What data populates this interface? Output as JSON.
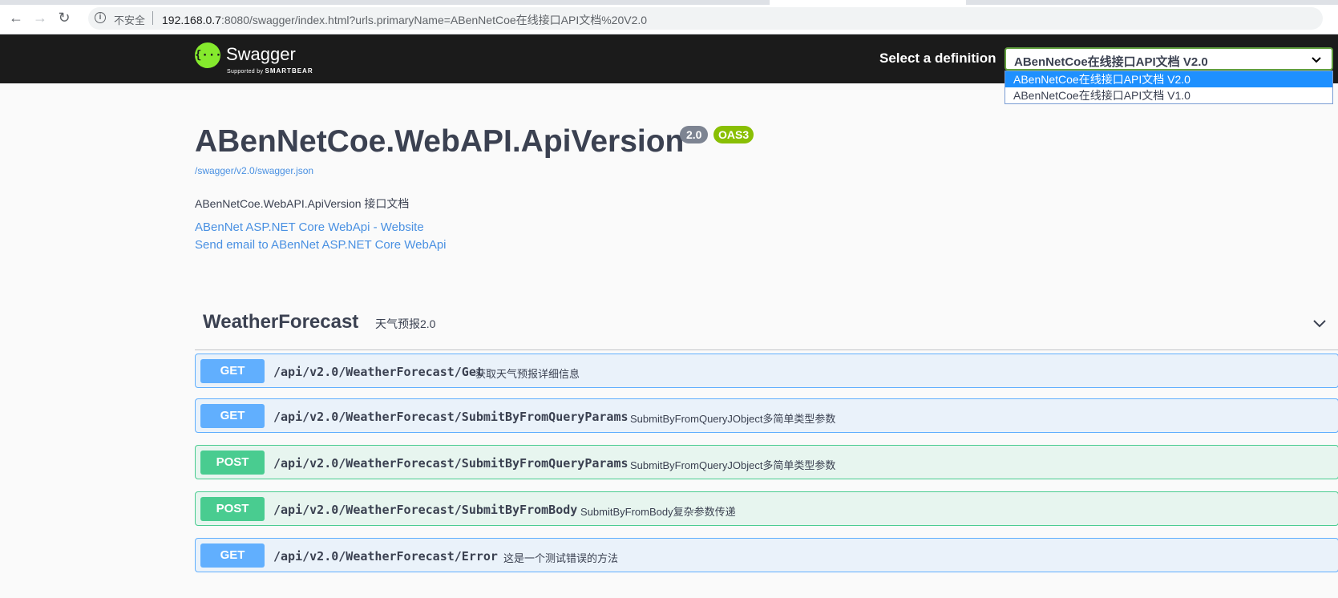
{
  "browser": {
    "insecure_label": "不安全",
    "url_host": "192.168.0.7",
    "url_rest": ":8080/swagger/index.html?urls.primaryName=ABenNetCoe在线接口API文档%20V2.0"
  },
  "topbar": {
    "logo_text": "Swagger",
    "logo_sub_prefix": "Supported by",
    "logo_sub_brand": "SMARTBEAR",
    "definition_label": "Select a definition",
    "definition_selected": "ABenNetCoe在线接口API文档 V2.0",
    "definition_options": [
      "ABenNetCoe在线接口API文档 V2.0",
      "ABenNetCoe在线接口API文档 V1.0"
    ]
  },
  "info": {
    "title": "ABenNetCoe.WebAPI.ApiVersion",
    "version": "2.0",
    "oas": "OAS3",
    "spec_url": "/swagger/v2.0/swagger.json",
    "description": "ABenNetCoe.WebAPI.ApiVersion 接口文档",
    "website_link": "ABenNet ASP.NET Core WebApi - Website",
    "email_link": "Send email to ABenNet ASP.NET Core WebApi"
  },
  "tag": {
    "name": "WeatherForecast",
    "description": "天气预报2.0"
  },
  "operations": [
    {
      "method": "GET",
      "path": "/api/v2.0/WeatherForecast/Get",
      "summary": "获取天气预报详细信息"
    },
    {
      "method": "GET",
      "path": "/api/v2.0/WeatherForecast/SubmitByFromQueryParams",
      "summary": "SubmitByFromQueryJObject多简单类型参数"
    },
    {
      "method": "POST",
      "path": "/api/v2.0/WeatherForecast/SubmitByFromQueryParams",
      "summary": "SubmitByFromQueryJObject多简单类型参数"
    },
    {
      "method": "POST",
      "path": "/api/v2.0/WeatherForecast/SubmitByFromBody",
      "summary": "SubmitByFromBody复杂参数传递"
    },
    {
      "method": "GET",
      "path": "/api/v2.0/WeatherForecast/Error",
      "summary": "这是一个测试错误的方法"
    }
  ]
}
